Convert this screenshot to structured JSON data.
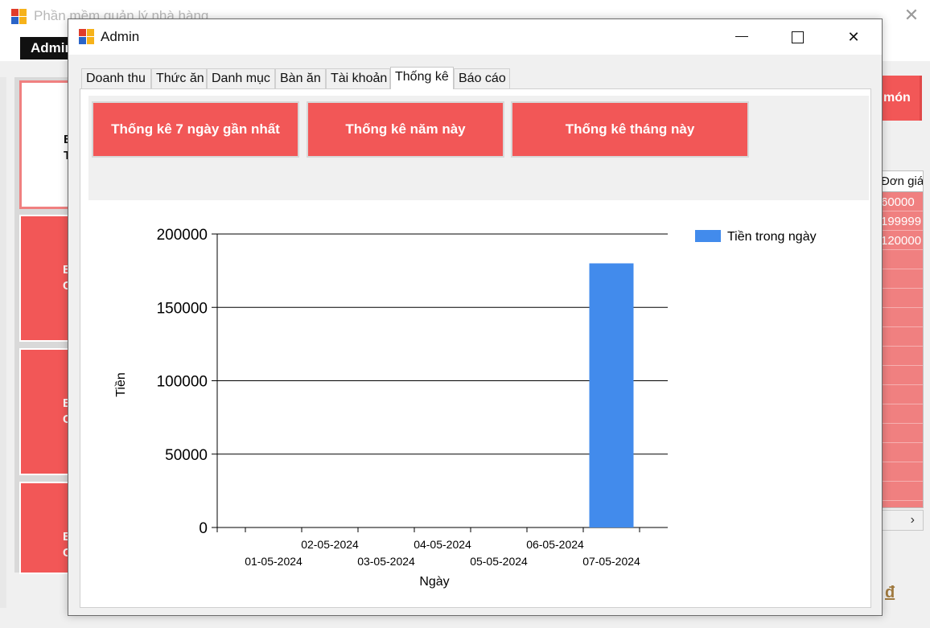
{
  "background_window": {
    "title": "Phần mềm quản lý nhà hàng",
    "menu_admin": "Admin",
    "tiles": [
      {
        "line1": "B",
        "line2": "T"
      },
      {
        "line1": "B",
        "line2": "Cố"
      },
      {
        "line1": "B",
        "line2": "Cố"
      },
      {
        "line1": "B",
        "line2": "Cố"
      }
    ],
    "right_button_label": "món",
    "grid_header": "Đơn giá",
    "grid_values": [
      "60000",
      "199999",
      "120000"
    ],
    "scroll_right_glyph": "›",
    "currency_label": "đ"
  },
  "dialog": {
    "title": "Admin",
    "controls": {
      "minimize": "—",
      "maximize": "☐",
      "close": "✕"
    },
    "tabs": [
      {
        "label": "Doanh thu",
        "active": false
      },
      {
        "label": "Thức ăn",
        "active": false
      },
      {
        "label": "Danh mục",
        "active": false
      },
      {
        "label": "Bàn ăn",
        "active": false
      },
      {
        "label": "Tài khoản",
        "active": false
      },
      {
        "label": "Thống kê",
        "active": true
      },
      {
        "label": "Báo cáo",
        "active": false
      }
    ],
    "buttons": {
      "last7": "Thống kê 7 ngày gần nhất",
      "this_year": "Thống kê năm này",
      "this_month": "Thống kê tháng này"
    }
  },
  "colors": {
    "accent_red": "#f25757",
    "bar_blue": "#428bec"
  },
  "chart_data": {
    "type": "bar",
    "title": "",
    "xlabel": "Ngày",
    "ylabel": "Tiền",
    "categories": [
      "01-05-2024",
      "02-05-2024",
      "03-05-2024",
      "04-05-2024",
      "05-05-2024",
      "06-05-2024",
      "07-05-2024"
    ],
    "series": [
      {
        "name": "Tiền trong ngày",
        "values": [
          0,
          0,
          0,
          0,
          0,
          0,
          180000
        ]
      }
    ],
    "ylim": [
      0,
      200000
    ],
    "yticks": [
      "0",
      "50000",
      "100000",
      "150000",
      "200000"
    ],
    "grid": "horizontal",
    "legend_position": "top-right"
  }
}
